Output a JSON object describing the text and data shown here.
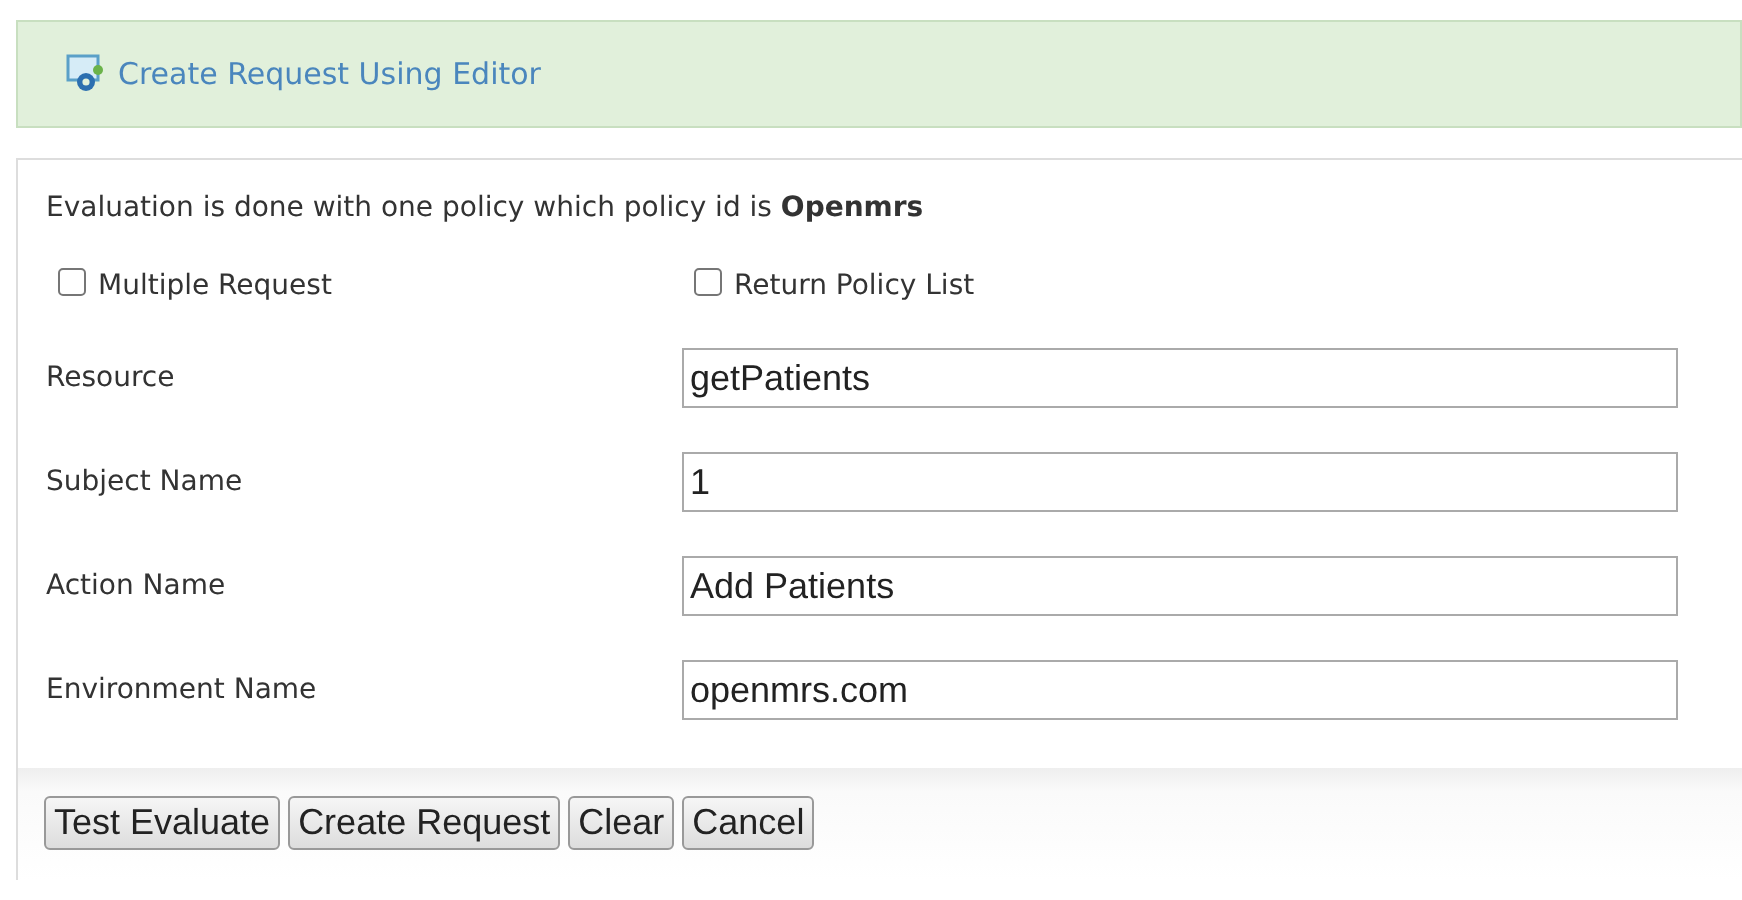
{
  "header": {
    "title": "Create Request Using Editor"
  },
  "intro": "Evaluation is done with one policy which policy id is **Openmrs**",
  "options": [
    {
      "label": "Multiple Request",
      "checked": false
    },
    {
      "label": "Return Policy List",
      "checked": false
    }
  ],
  "fields": [
    {
      "label": "Resource",
      "value": "getPatients"
    },
    {
      "label": "Subject Name",
      "value": "1"
    },
    {
      "label": "Action Name",
      "value": "Add Patients"
    },
    {
      "label": "Environment Name",
      "value": "openmrs.com"
    }
  ],
  "buttons": [
    "Test Evaluate",
    "Create Request",
    "Clear",
    "Cancel"
  ]
}
